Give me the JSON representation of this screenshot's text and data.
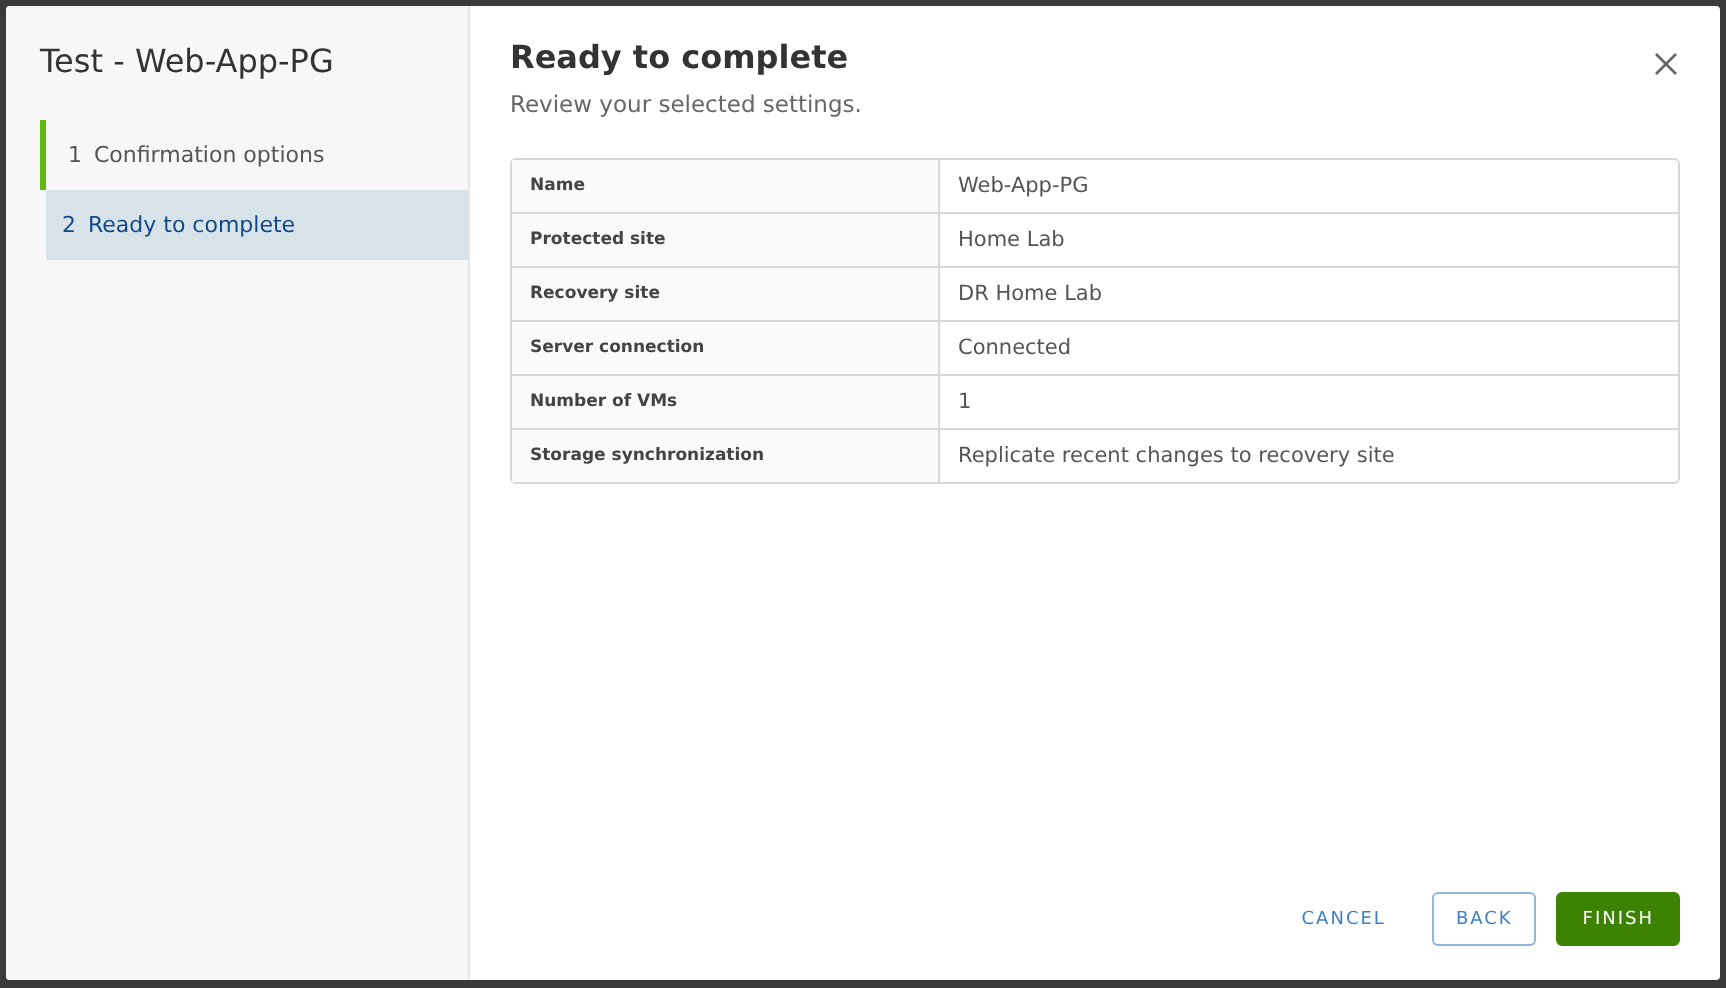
{
  "wizard": {
    "title": "Test - Web-App-PG"
  },
  "steps": [
    {
      "number": "1",
      "label": "Confirmation options",
      "completed": true,
      "selected": false
    },
    {
      "number": "2",
      "label": "Ready to complete",
      "completed": false,
      "selected": true
    }
  ],
  "page": {
    "title": "Ready to complete",
    "subtitle": "Review your selected settings."
  },
  "settings": [
    {
      "label": "Name",
      "value": "Web-App-PG"
    },
    {
      "label": "Protected site",
      "value": "Home Lab"
    },
    {
      "label": "Recovery site",
      "value": "DR Home Lab"
    },
    {
      "label": "Server connection",
      "value": "Connected"
    },
    {
      "label": "Number of VMs",
      "value": "1"
    },
    {
      "label": "Storage synchronization",
      "value": "Replicate recent changes to recovery site"
    }
  ],
  "buttons": [
    {
      "label": "CANCEL",
      "kind": "link"
    },
    {
      "label": "BACK",
      "kind": "outline"
    },
    {
      "label": "FINISH",
      "kind": "primary"
    }
  ]
}
